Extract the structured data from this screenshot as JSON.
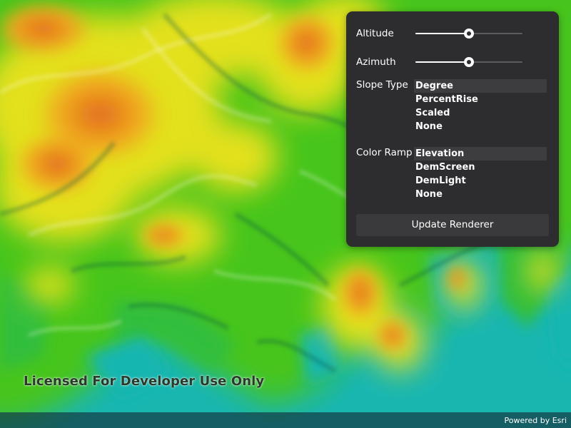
{
  "watermark": {
    "text": "Licensed For Developer Use Only"
  },
  "attribution": {
    "text": "Powered by Esri"
  },
  "panel": {
    "altitude": {
      "label": "Altitude",
      "value_fraction": 0.5
    },
    "azimuth": {
      "label": "Azimuth",
      "value_fraction": 0.5
    },
    "slope_type": {
      "label": "Slope Type",
      "options": [
        "Degree",
        "PercentRise",
        "Scaled",
        "None"
      ],
      "selected": "Degree"
    },
    "color_ramp": {
      "label": "Color Ramp",
      "options": [
        "Elevation",
        "DemScreen",
        "DemLight",
        "None"
      ],
      "selected": "Elevation"
    },
    "update_button": {
      "label": "Update Renderer"
    }
  },
  "colors": {
    "panel_background": "#2d2d30",
    "lowland": "#19b6b0",
    "midland": "#4cc81e",
    "highland": "#f5e11e",
    "peak": "#e98a23"
  },
  "icons": {
    "slider_thumb": "circle-thumb-icon"
  }
}
